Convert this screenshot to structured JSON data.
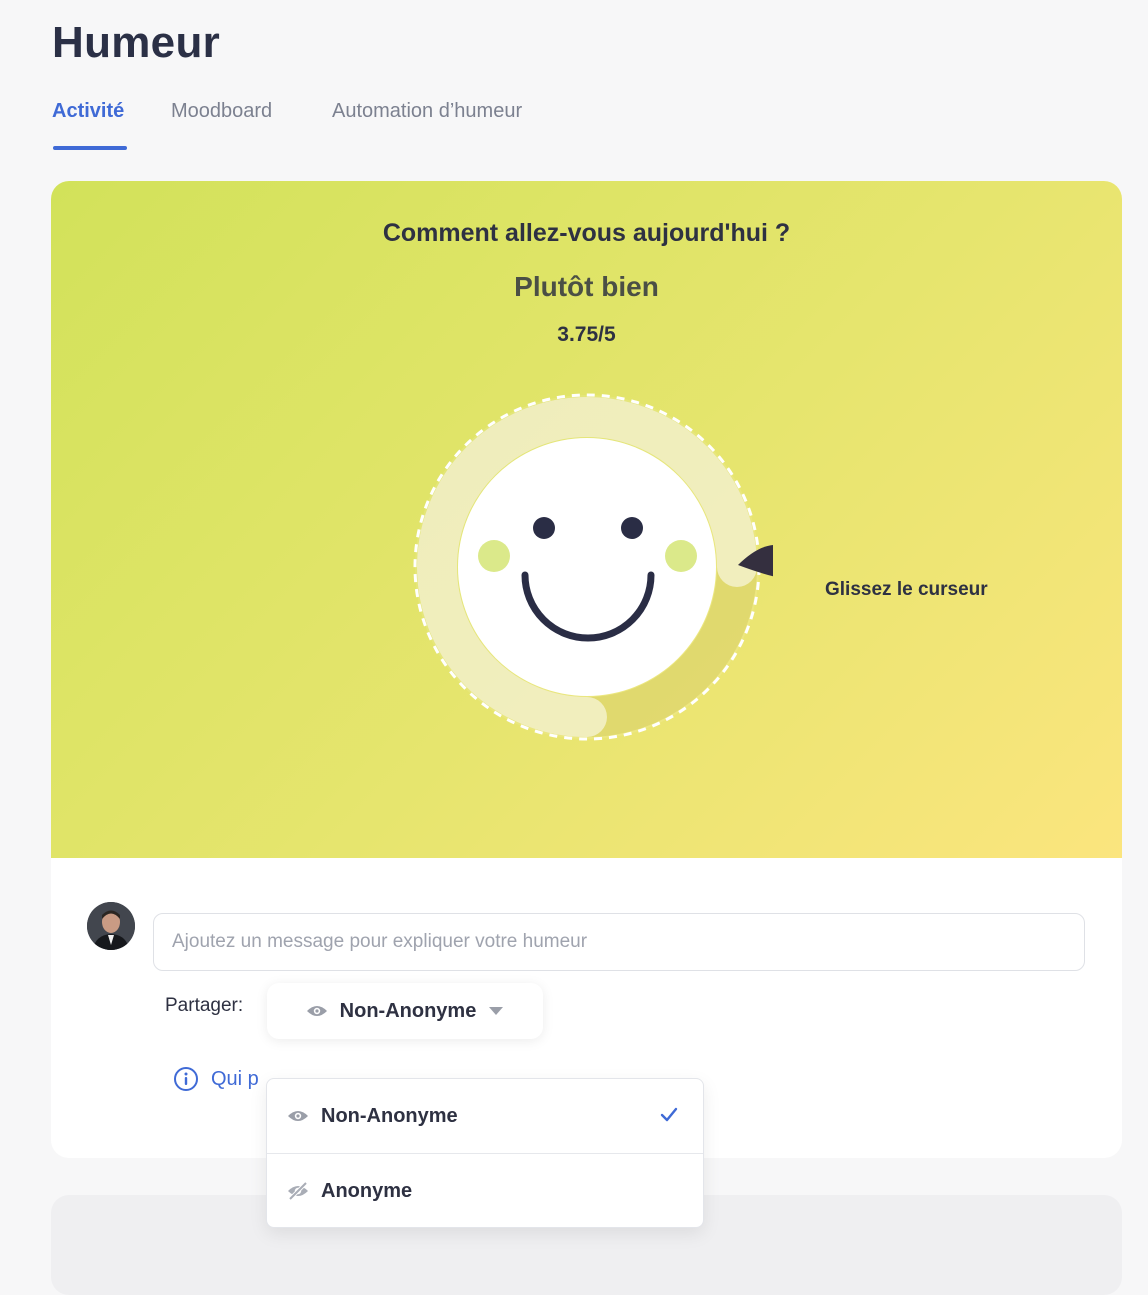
{
  "page": {
    "title": "Humeur"
  },
  "tabs": [
    {
      "label": "Activité",
      "active": true
    },
    {
      "label": "Moodboard",
      "active": false
    },
    {
      "label": "Automation d’humeur",
      "active": false
    }
  ],
  "mood": {
    "question": "Comment allez-vous aujourd'hui ?",
    "label": "Plutôt bien",
    "score": "3.75/5",
    "score_value": 3.75,
    "score_max": 5,
    "slider_hint": "Glissez le curseur"
  },
  "composer": {
    "message_placeholder": "Ajoutez un message pour expliquer votre humeur",
    "share_label": "Partager:",
    "share_selected": "Non-Anonyme",
    "info_text_visible": "Qui p"
  },
  "share_dropdown": {
    "options": [
      {
        "label": "Non-Anonyme",
        "icon": "eye-icon",
        "selected": true
      },
      {
        "label": "Anonyme",
        "icon": "eye-off-icon",
        "selected": false
      }
    ]
  },
  "colors": {
    "accent": "#3f6ad6",
    "hero_gradient_start": "#d2e25a",
    "hero_gradient_end": "#fbe57e",
    "text_dark": "#2e3142"
  }
}
